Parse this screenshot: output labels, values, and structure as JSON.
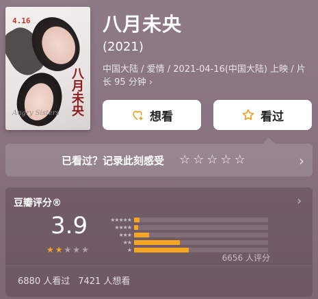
{
  "movie": {
    "title": "八月未央",
    "year": "(2021)",
    "meta": "中国大陆 / 爱情 / 2021-04-16(中国大陆) 上映 / 片长 95 分钟 ›",
    "poster": {
      "date": "4.16",
      "vertical_title": "八月未央",
      "subtitle": "Angry Sisters"
    }
  },
  "actions": {
    "want_label": "想看",
    "seen_label": "看过"
  },
  "record": {
    "prompt": "已看过？记录此刻感受",
    "star_count": 5
  },
  "rating": {
    "header": "豆瓣评分®",
    "score": "3.9",
    "stars_filled": 2,
    "stars_total": 5,
    "distribution": [
      {
        "label": "★★★★★",
        "fraction": 0.04
      },
      {
        "label": "★★★★",
        "fraction": 0.03
      },
      {
        "label": "★★★",
        "fraction": 0.11
      },
      {
        "label": "★★",
        "fraction": 0.34
      },
      {
        "label": "★",
        "fraction": 0.41
      }
    ],
    "rating_count": "6656 人评分",
    "seen_count": "6880 人看过",
    "want_count": "7421 人想看"
  },
  "colors": {
    "accent": "#f5a623",
    "background": "#8f7b86"
  }
}
